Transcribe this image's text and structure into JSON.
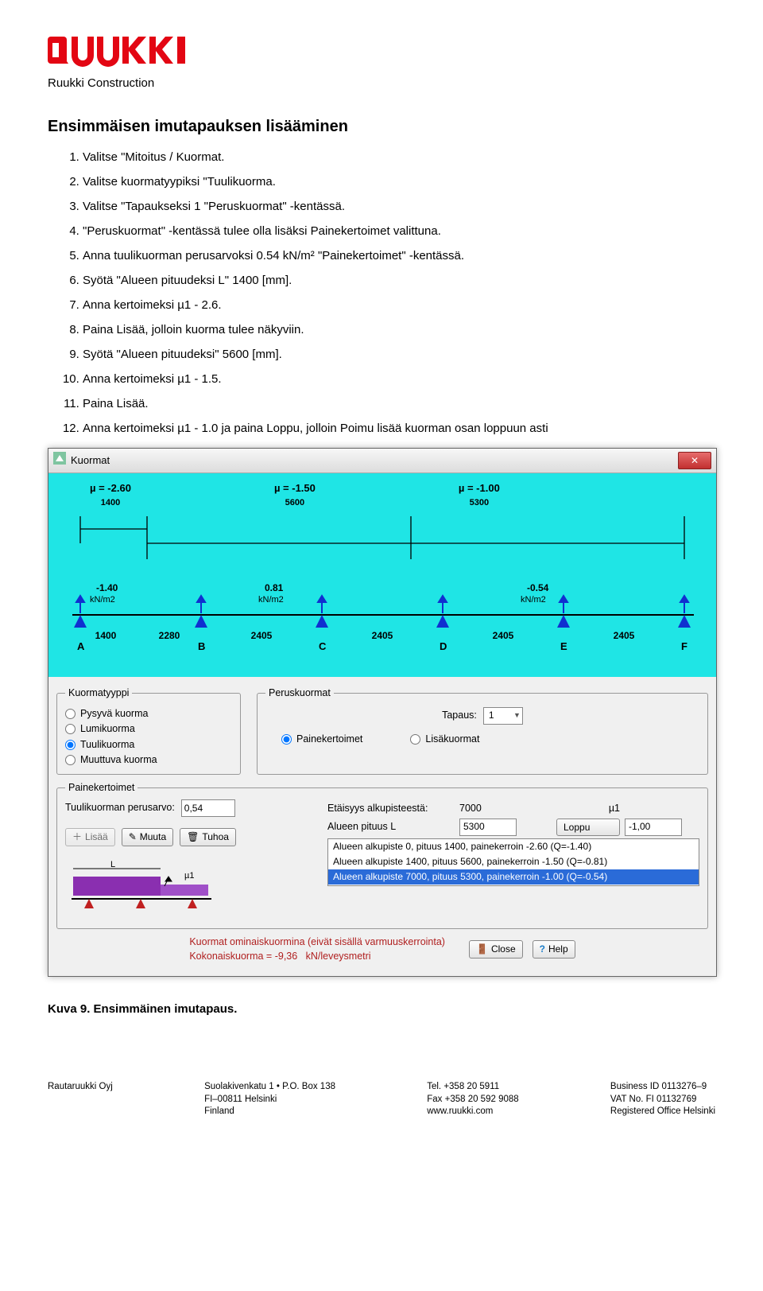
{
  "header": {
    "brand_sub": "Ruukki Construction"
  },
  "section": {
    "title": "Ensimmäisen imutapauksen lisääminen",
    "steps": [
      "Valitse \"Mitoitus / Kuormat.",
      "Valitse kuormatyypiksi \"Tuulikuorma.",
      "Valitse \"Tapaukseksi 1 \"Peruskuormat\" -kentässä.",
      "\"Peruskuormat\" -kentässä tulee olla lisäksi Painekertoimet valittuna.",
      "Anna tuulikuorman perusarvoksi 0.54 kN/m² \"Painekertoimet\" -kentässä.",
      "Syötä \"Alueen pituudeksi L\" 1400 [mm].",
      "Anna kertoimeksi µ1 - 2.6.",
      "Paina Lisää, jolloin kuorma tulee näkyviin.",
      "Syötä \"Alueen pituudeksi\" 5600 [mm].",
      "Anna kertoimeksi µ1 - 1.5.",
      "Paina Lisää.",
      "Anna kertoimeksi µ1 - 1.0 ja paina Loppu, jolloin Poimu lisää kuorman osan loppuun asti"
    ]
  },
  "dialog": {
    "title": "Kuormat",
    "mu": [
      {
        "mu": "µ = -2.60",
        "span": "1400"
      },
      {
        "mu": "µ = -1.50",
        "span": "5600"
      },
      {
        "mu": "µ = -1.00",
        "span": "5300"
      }
    ],
    "loads": [
      "-1.40",
      "0.81",
      "-0.54"
    ],
    "unit": "kN/m2",
    "span_values": [
      "1400",
      "2280",
      "2405",
      "2405",
      "2405",
      "2405",
      "2405"
    ],
    "supports": [
      "A",
      "B",
      "C",
      "D",
      "E",
      "F"
    ],
    "kuormatyyppi": {
      "legend": "Kuormatyyppi",
      "options": [
        "Pysyvä kuorma",
        "Lumikuorma",
        "Tuulikuorma",
        "Muuttuva kuorma"
      ],
      "selected": "Tuulikuorma"
    },
    "peruskuormat": {
      "legend": "Peruskuormat",
      "tapaus_label": "Tapaus:",
      "tapaus_value": "1",
      "radios": [
        "Painekertoimet",
        "Lisäkuormat"
      ],
      "selected": "Painekertoimet"
    },
    "painekertoimet": {
      "legend": "Painekertoimet",
      "label_perusarvo": "Tuulikuorman perusarvo:",
      "value_perusarvo": "0,54",
      "etaisyys_label": "Etäisyys alkupisteestä:",
      "etaisyys_value": "7000",
      "mu1_label": "µ1",
      "alueen_label": "Alueen pituus L",
      "alueen_value": "5300",
      "mu1_value": "-1,00",
      "loppu_btn": "Loppu",
      "buttons": {
        "lisaa": "Lisää",
        "muuta": "Muuta",
        "tuhoa": "Tuhoa"
      },
      "listbox": [
        "Alueen alkupiste 0, pituus 1400, painekerroin -2.60  (Q=-1.40)",
        "Alueen alkupiste 1400, pituus 5600, painekerroin -1.50  (Q=-0.81)",
        "Alueen alkupiste 7000, pituus 5300, painekerroin -1.00  (Q=-0.54)"
      ],
      "listbox_selected": 2,
      "illus_label_mu": "µ1",
      "illus_label_L": "L"
    },
    "footer": {
      "text1": "Kuormat ominaiskuormina (eivät sisällä varmuuskerrointa)",
      "kk_label": "Kokonaiskuorma =",
      "kk_value": "-9,36",
      "kk_unit": "kN/leveysmetri",
      "close_btn": "Close",
      "help_btn": "Help"
    }
  },
  "caption": "Kuva 9. Ensimmäinen imutapaus.",
  "pageFooter": {
    "c1": [
      "Rautaruukki Oyj"
    ],
    "c2": [
      "Suolakivenkatu 1 • P.O. Box 138",
      "FI–00811 Helsinki",
      "Finland"
    ],
    "c3": [
      "Tel. +358 20 5911",
      "Fax +358 20 592 9088",
      "www.ruukki.com"
    ],
    "c4": [
      "Business ID 0113276–9",
      "VAT No. FI 01132769",
      "Registered Office Helsinki"
    ]
  }
}
